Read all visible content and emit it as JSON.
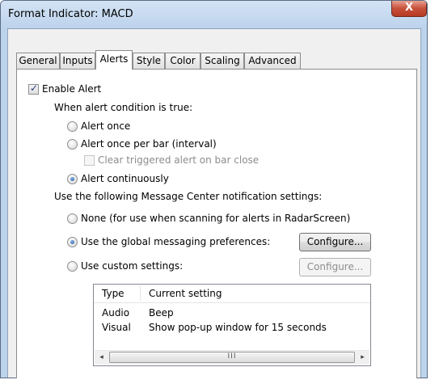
{
  "window": {
    "title": "Format Indicator: MACD",
    "close_glyph": "X"
  },
  "tabs": [
    {
      "label": "General",
      "active": false
    },
    {
      "label": "Inputs",
      "active": false
    },
    {
      "label": "Alerts",
      "active": true
    },
    {
      "label": "Style",
      "active": false
    },
    {
      "label": "Color",
      "active": false
    },
    {
      "label": "Scaling",
      "active": false
    },
    {
      "label": "Advanced",
      "active": false
    }
  ],
  "alerts": {
    "enable_alert": {
      "label": "Enable Alert",
      "checked": true
    },
    "condition_label": "When alert condition is true:",
    "alert_once": {
      "label": "Alert once",
      "selected": false
    },
    "alert_once_per_bar": {
      "label": "Alert once per bar (interval)",
      "selected": false
    },
    "clear_triggered": {
      "label": "Clear triggered alert on bar close",
      "checked": false,
      "enabled": false
    },
    "alert_continuously": {
      "label": "Alert continuously",
      "selected": true
    },
    "notification_label": "Use the following Message Center notification settings:",
    "none_option": {
      "label": "None (for use when scanning for alerts in RadarScreen)",
      "selected": false
    },
    "global_option": {
      "label": "Use the global messaging preferences:",
      "selected": true
    },
    "custom_option": {
      "label": "Use custom settings:",
      "selected": false
    },
    "configure_global": {
      "label": "Configure...",
      "enabled": true
    },
    "configure_custom": {
      "label": "Configure...",
      "enabled": false
    }
  },
  "settings_table": {
    "columns": [
      "Type",
      "Current setting"
    ],
    "rows": [
      {
        "type": "Audio",
        "setting": "Beep"
      },
      {
        "type": "Visual",
        "setting": "Show pop-up window for 15 seconds"
      }
    ],
    "scroll_left_glyph": "◂",
    "scroll_right_glyph": "▸",
    "thumb_grip": "III"
  }
}
